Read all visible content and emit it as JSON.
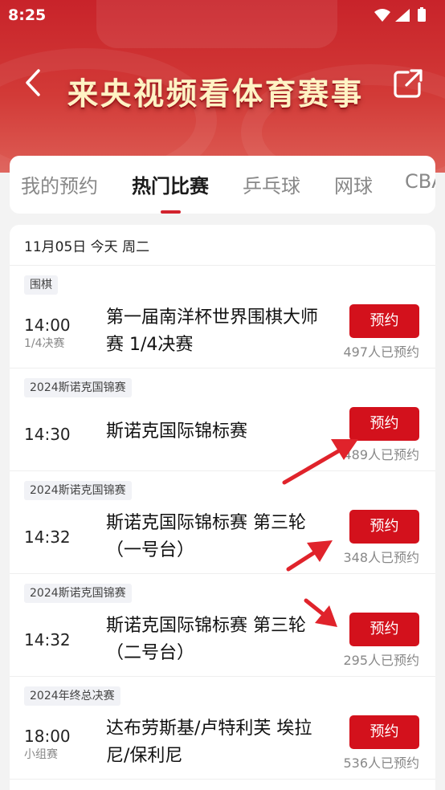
{
  "status_bar": {
    "time": "8:25"
  },
  "header": {
    "title": "来央视频看体育赛事"
  },
  "tabs": [
    {
      "label": "我的预约"
    },
    {
      "label": "热门比赛"
    },
    {
      "label": "乒乓球"
    },
    {
      "label": "网球"
    },
    {
      "label": "CBA"
    }
  ],
  "list": {
    "date_header": "11月05日 今天 周二",
    "reserve_label": "预约",
    "matches": [
      {
        "tag": "围棋",
        "time": "14:00",
        "stage": "1/4决赛",
        "title": "第一届南洋杯世界围棋大师赛 1/4决赛",
        "count": "497人已预约"
      },
      {
        "tag": "2024斯诺克国锦赛",
        "time": "14:30",
        "stage": "",
        "title": "斯诺克国际锦标赛",
        "count": "489人已预约"
      },
      {
        "tag": "2024斯诺克国锦赛",
        "time": "14:32",
        "stage": "",
        "title": "斯诺克国际锦标赛 第三轮（一号台）",
        "count": "348人已预约"
      },
      {
        "tag": "2024斯诺克国锦赛",
        "time": "14:32",
        "stage": "",
        "title": "斯诺克国际锦标赛 第三轮（二号台）",
        "count": "295人已预约"
      },
      {
        "tag": "2024年终总决赛",
        "time": "18:00",
        "stage": "小组赛",
        "title": "达布劳斯基/卢特利芙 埃拉尼/保利尼",
        "count": "536人已预约"
      }
    ]
  },
  "colors": {
    "brand_red": "#d3111c",
    "header_red": "#c8232a",
    "annotation_red": "#e0232b"
  },
  "icons": {
    "back": "back-arrow-icon",
    "share": "share-icon",
    "wifi": "wifi-icon",
    "signal": "cell-signal-icon",
    "battery": "battery-icon"
  }
}
